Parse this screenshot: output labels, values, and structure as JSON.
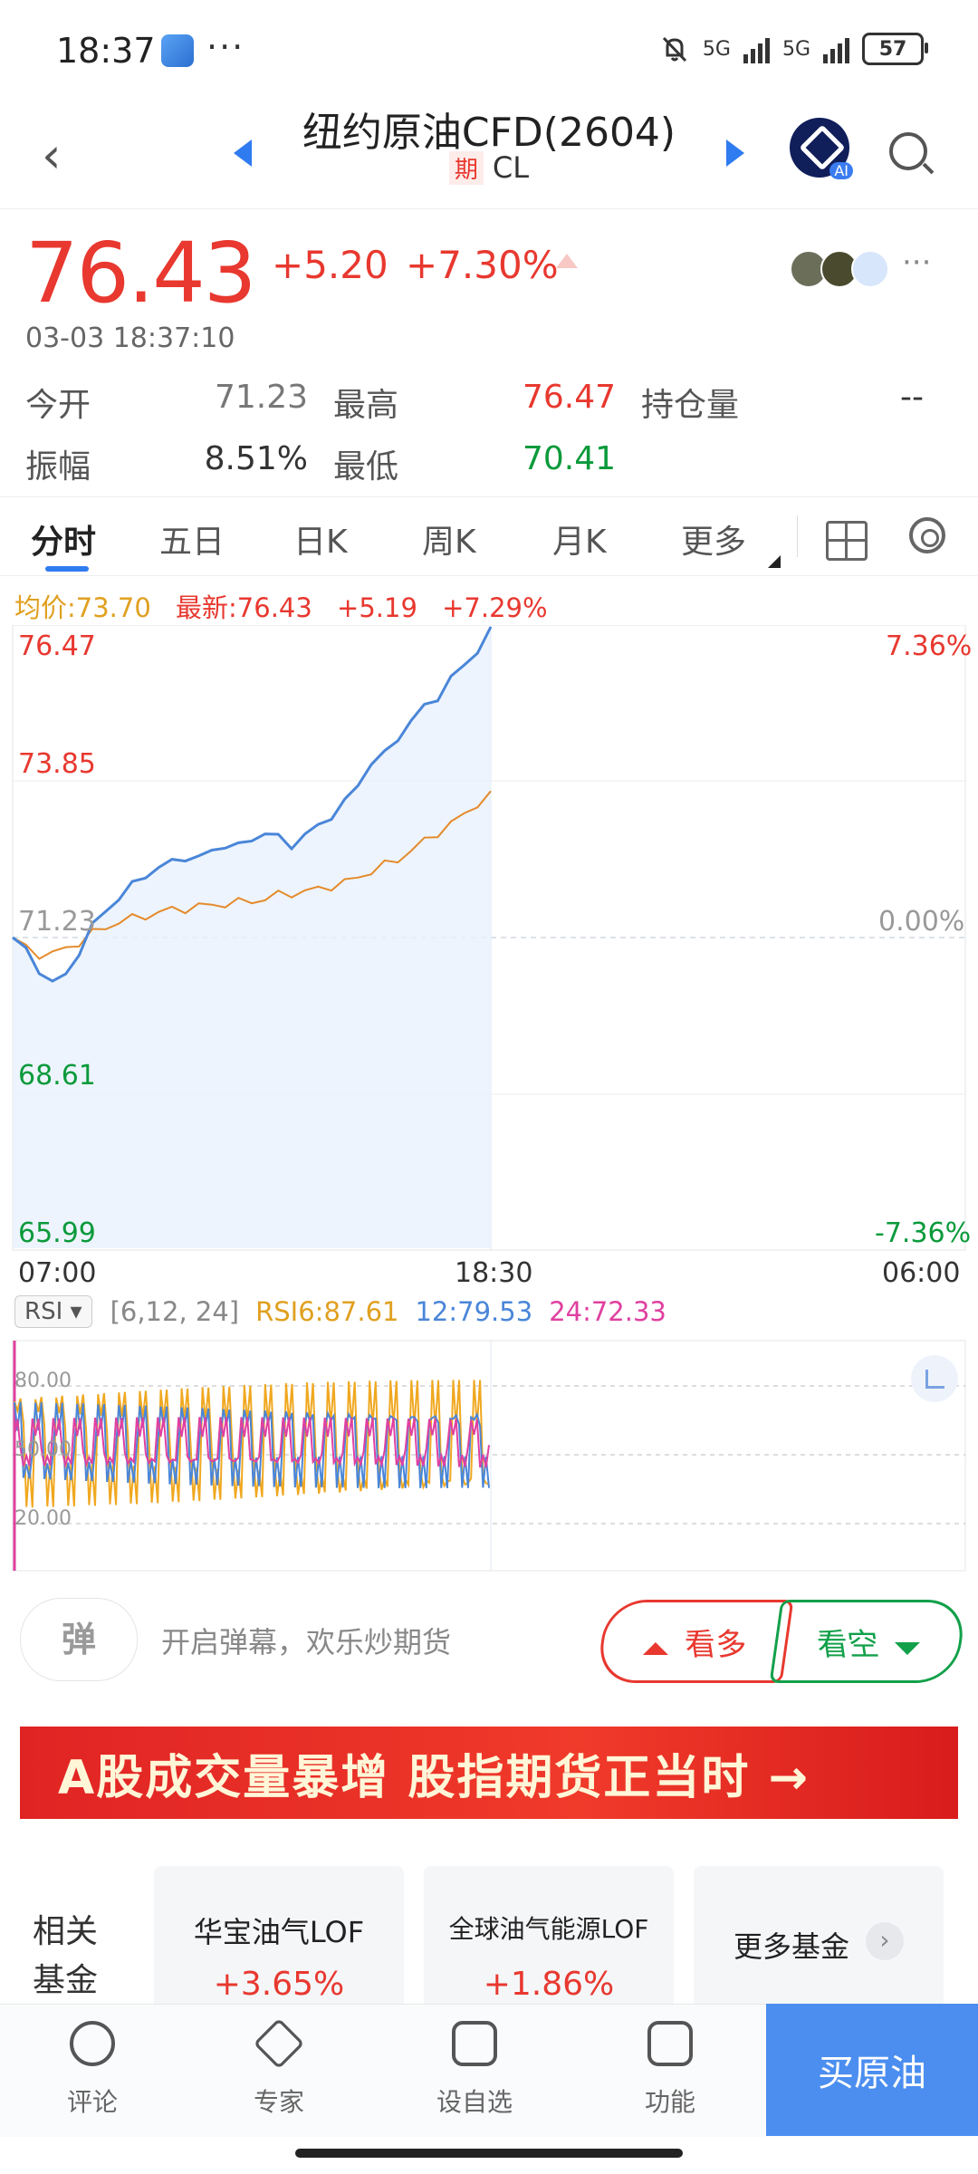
{
  "status_bar": {
    "time": "18:37",
    "network1": "5G",
    "network2": "5G",
    "battery": "57"
  },
  "nav": {
    "title": "纽约原油CFD(2604)",
    "badge": "期",
    "code": "CL",
    "ai_label": "AI"
  },
  "quote": {
    "price": "76.43",
    "change": "+5.20",
    "change_pct": "+7.30%",
    "timestamp": "03-03 18:37:10"
  },
  "stats": {
    "open_label": "今开",
    "open": "71.23",
    "high_label": "最高",
    "high": "76.47",
    "oi_label": "持仓量",
    "oi": "--",
    "amp_label": "振幅",
    "amp": "8.51%",
    "low_label": "最低",
    "low": "70.41"
  },
  "tabs": [
    "分时",
    "五日",
    "日K",
    "周K",
    "月K",
    "更多"
  ],
  "info_line": {
    "avg": "均价:73.70",
    "latest": "最新:76.43",
    "chg": "+5.19",
    "pct": "+7.29%"
  },
  "chart_axes": {
    "y_left": [
      "76.47",
      "73.85",
      "71.23",
      "68.61",
      "65.99"
    ],
    "y_right": [
      "7.36%",
      "0.00%",
      "-7.36%"
    ],
    "x": [
      "07:00",
      "18:30",
      "06:00"
    ]
  },
  "chart_data": {
    "type": "line",
    "xlabel": "",
    "ylabel": "",
    "ylim": [
      65.99,
      76.47
    ],
    "x_ticks": [
      "07:00",
      "18:30",
      "06:00"
    ],
    "series": [
      {
        "name": "最新",
        "color": "#4a86d8",
        "values": [
          71.23,
          71.0,
          70.7,
          70.45,
          70.6,
          71.0,
          71.4,
          71.7,
          71.9,
          72.1,
          72.3,
          72.4,
          72.5,
          72.6,
          72.55,
          72.7,
          72.8,
          72.75,
          72.9,
          73.0,
          72.9,
          72.8,
          72.95,
          73.1,
          73.3,
          73.5,
          73.8,
          74.2,
          74.3,
          74.6,
          74.9,
          75.1,
          75.3,
          75.6,
          75.8,
          76.1,
          76.47
        ]
      },
      {
        "name": "均价",
        "color": "#e58a2a",
        "values": [
          71.23,
          71.05,
          70.95,
          70.95,
          71.05,
          71.15,
          71.3,
          71.4,
          71.5,
          71.55,
          71.6,
          71.65,
          71.7,
          71.72,
          71.75,
          71.78,
          71.8,
          71.82,
          71.85,
          71.88,
          71.95,
          71.98,
          72.0,
          72.05,
          72.1,
          72.15,
          72.25,
          72.35,
          72.45,
          72.55,
          72.7,
          72.85,
          73.0,
          73.15,
          73.3,
          73.5,
          73.7
        ]
      }
    ],
    "prev_close": 71.23
  },
  "rsi": {
    "button": "RSI",
    "params": "[6,12, 24]",
    "rsi6": "RSI6:87.61",
    "rsi12": "12:79.53",
    "rsi24": "24:72.33",
    "levels": [
      "80.00",
      "50.00",
      "20.00"
    ]
  },
  "danmaku": {
    "icon": "弹",
    "placeholder": "开启弹幕，欢乐炒期货",
    "bull": "看多",
    "bear": "看空"
  },
  "banner": {
    "text": "A股成交量暴增 股指期货正当时 →"
  },
  "funds": {
    "label": "相关基金",
    "items": [
      {
        "name": "华宝油气LOF",
        "pct": "+3.65%"
      },
      {
        "name": "全球油气能源LOF",
        "pct": "+1.86%"
      }
    ],
    "more": "更多基金"
  },
  "bottom_bar": {
    "comment": "评论",
    "expert": "专家",
    "watch": "设自选",
    "func": "功能",
    "buy": "买原油"
  },
  "colors": {
    "up": "#e8382f",
    "down": "#0b9a3b",
    "accent": "#2f7bf0",
    "price_line": "#4a86d8",
    "avg_line": "#e58a2a"
  }
}
